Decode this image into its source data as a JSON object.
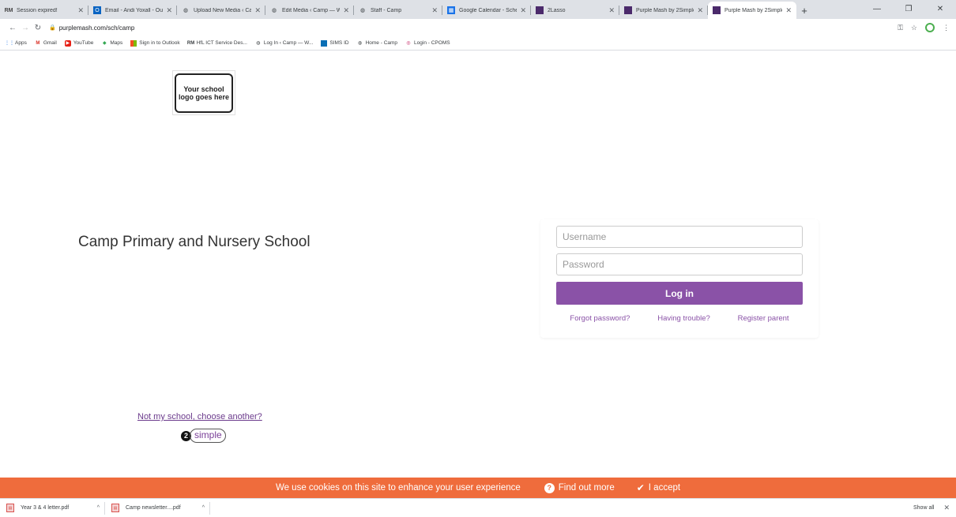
{
  "browser": {
    "tabs": [
      {
        "title": "Session expired!",
        "icon": "rm-icon"
      },
      {
        "title": "Email - Andi Yoxall - Outl",
        "icon": "outlook-icon"
      },
      {
        "title": "Upload New Media ‹ Cam",
        "icon": "globe-icon"
      },
      {
        "title": "Edit Media ‹ Camp — Wo",
        "icon": "globe-icon"
      },
      {
        "title": "Staff - Camp",
        "icon": "globe-icon"
      },
      {
        "title": "Google Calendar - Schedu",
        "icon": "calendar-icon"
      },
      {
        "title": "2Lasso",
        "icon": "purplemash-icon"
      },
      {
        "title": "Purple Mash by 2Simple",
        "icon": "purplemash-icon"
      },
      {
        "title": "Purple Mash by 2Simple",
        "icon": "purplemash-icon",
        "active": true
      }
    ],
    "url": "purplemash.com/sch/camp",
    "bookmarks": [
      {
        "label": "Apps",
        "icon": "apps-icon"
      },
      {
        "label": "Gmail",
        "icon": "gmail-icon"
      },
      {
        "label": "YouTube",
        "icon": "youtube-icon"
      },
      {
        "label": "Maps",
        "icon": "maps-icon"
      },
      {
        "label": "Sign in to Outlook",
        "icon": "microsoft-icon"
      },
      {
        "label": "HfL ICT Service Des...",
        "icon": "rm-icon"
      },
      {
        "label": "Log In ‹ Camp — W...",
        "icon": "globe-icon"
      },
      {
        "label": "SIMS ID",
        "icon": "sims-icon"
      },
      {
        "label": "Home - Camp",
        "icon": "globe-icon"
      },
      {
        "label": "Login - CPOMS",
        "icon": "cpoms-icon"
      }
    ]
  },
  "page": {
    "logo_text": "Your school logo goes here",
    "school_name": "Camp Primary and Nursery School",
    "login": {
      "username_placeholder": "Username",
      "password_placeholder": "Password",
      "login_label": "Log in",
      "forgot": "Forgot password?",
      "trouble": "Having trouble?",
      "register": "Register parent"
    },
    "not_my_school": "Not my school, choose another?",
    "brand_digit": "2",
    "brand_word": "simple"
  },
  "cookie": {
    "message": "We use cookies on this site to enhance your user experience",
    "find_out": "Find out more",
    "accept": "I accept"
  },
  "downloads": {
    "items": [
      "Year 3 & 4 letter.pdf",
      "Camp newsletter....pdf"
    ],
    "show_all": "Show all"
  },
  "colors": {
    "accent": "#8a52a7",
    "cookie": "#ef6c3c"
  }
}
